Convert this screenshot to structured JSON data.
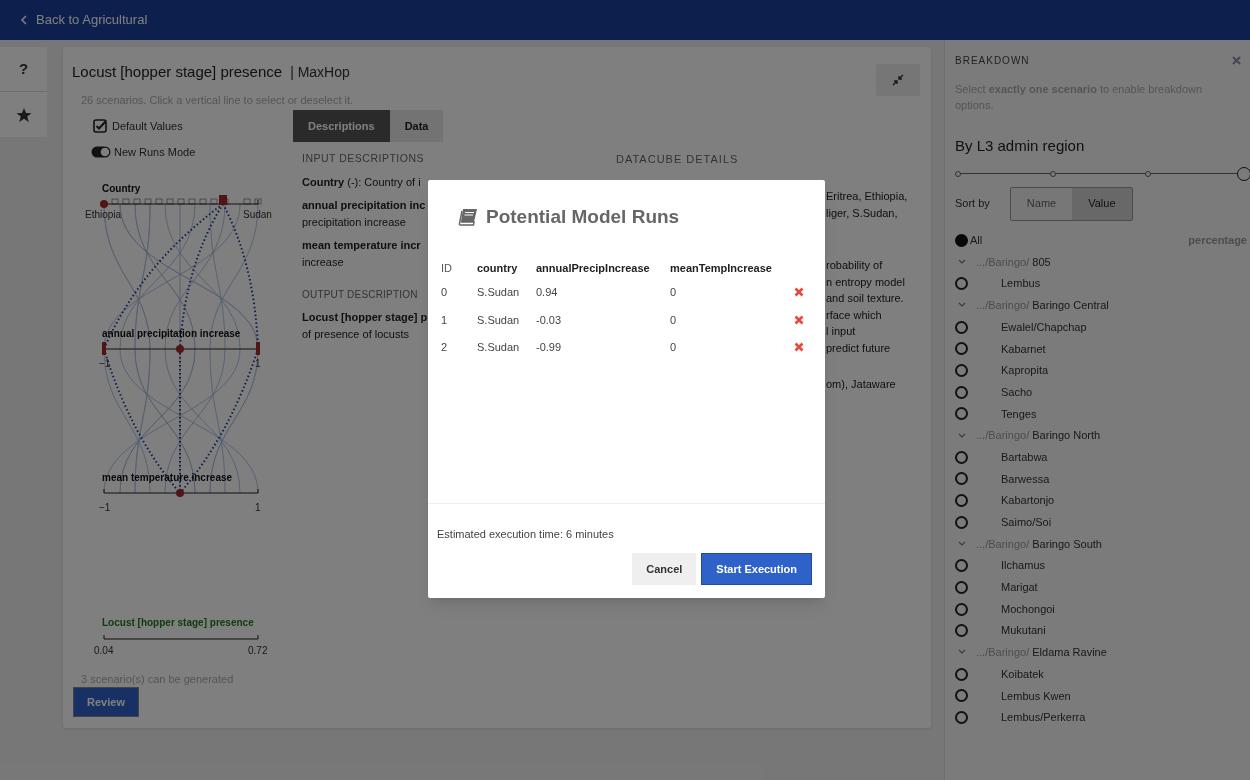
{
  "header": {
    "back_link": "Back to Agricultural"
  },
  "rail": {
    "help_button": "?"
  },
  "card": {
    "title": "Locust [hopper stage] presence",
    "model": "| MaxHop",
    "subtitle": "26 scenarios. Click a vertical line to select or deselect it.",
    "default_values": {
      "label": "Default Values",
      "checked": true
    },
    "new_runs_mode": {
      "label": "New Runs Mode",
      "on": true
    },
    "plot": {
      "axes": [
        {
          "label": "Country",
          "tick_min": "Ethiopia",
          "tick_max": "Sudan"
        },
        {
          "label": "annual precipitation increase",
          "tick_min": "−1",
          "tick_max": "1"
        },
        {
          "label": "mean temperature increase",
          "tick_min": "−1",
          "tick_max": "1"
        }
      ],
      "output_axis": {
        "label": "Locust [hopper stage] presence",
        "tick_min": "0.04",
        "tick_max": "0.72"
      }
    },
    "generated_note": "3 scenario(s) can be generated",
    "review_button": "Review"
  },
  "tabs": [
    {
      "label": "Descriptions",
      "selected": true
    },
    {
      "label": "Data",
      "selected": false
    }
  ],
  "input_descriptions": {
    "heading": "INPUT DESCRIPTIONS",
    "items": [
      [
        "**Country** (-): Country of i"
      ],
      [
        "**annual precipitation inc**",
        "precipitation increase"
      ],
      [
        "**mean temperature incr**",
        "increase"
      ]
    ]
  },
  "output_description": {
    "heading": "OUTPUT DESCRIPTION",
    "items": [
      [
        "**Locust [hopper stage] p**",
        "of presence of locusts"
      ]
    ]
  },
  "datacube_details": {
    "heading": "DATACUBE DETAILS",
    "paragraphs": [
      [
        "Eritrea, Ethiopia,",
        "liger, S.Sudan,"
      ],
      [
        "robability of",
        "n entropy model",
        "and soil texture.",
        "rface which",
        "l input",
        "predict future"
      ],
      [
        "om), Jataware"
      ]
    ]
  },
  "breakdown": {
    "heading": "BREAKDOWN",
    "hint": "Select **exactly one scenario** to enable breakdown options.",
    "level_title": "By L3 admin region",
    "levels": [
      {
        "selected": false
      },
      {
        "selected": false
      },
      {
        "selected": false
      },
      {
        "selected": true
      }
    ],
    "sort_label": "Sort by",
    "sort_options": [
      {
        "label": "Name",
        "selected": false
      },
      {
        "label": "Value",
        "selected": true
      }
    ],
    "all": {
      "label": "All",
      "selected": true
    },
    "column_label": "percentage",
    "regions": [
      {
        "prefix": ".../Baringo/",
        "name": "805",
        "expanded": true,
        "children": [
          {
            "name": "Lembus",
            "selected": false
          }
        ]
      },
      {
        "prefix": ".../Baringo/",
        "name": "Baringo Central",
        "expanded": true,
        "children": [
          {
            "name": "Ewalel/Chapchap",
            "selected": false
          },
          {
            "name": "Kabarnet",
            "selected": false
          },
          {
            "name": "Kapropita",
            "selected": false
          },
          {
            "name": "Sacho",
            "selected": false
          },
          {
            "name": "Tenges",
            "selected": false
          }
        ]
      },
      {
        "prefix": ".../Baringo/",
        "name": "Baringo North",
        "expanded": true,
        "children": [
          {
            "name": "Bartabwa",
            "selected": false
          },
          {
            "name": "Barwessa",
            "selected": false
          },
          {
            "name": "Kabartonjo",
            "selected": false
          },
          {
            "name": "Saimo/Soi",
            "selected": false
          }
        ]
      },
      {
        "prefix": ".../Baringo/",
        "name": "Baringo South",
        "expanded": true,
        "children": [
          {
            "name": "Ilchamus",
            "selected": false
          },
          {
            "name": "Marigat",
            "selected": false
          },
          {
            "name": "Mochongoi",
            "selected": false
          },
          {
            "name": "Mukutani",
            "selected": false
          }
        ]
      },
      {
        "prefix": ".../Baringo/",
        "name": "Eldama Ravine",
        "expanded": true,
        "children": [
          {
            "name": "Koibatek",
            "selected": false
          },
          {
            "name": "Lembus Kwen",
            "selected": false
          },
          {
            "name": "Lembus/Perkerra",
            "selected": false
          }
        ]
      }
    ]
  },
  "modal": {
    "title": "Potential Model Runs",
    "columns": [
      "ID",
      "country",
      "annualPrecipIncrease",
      "meanTempIncrease"
    ],
    "rows": [
      [
        "0",
        "S.Sudan",
        "0.94",
        "0"
      ],
      [
        "1",
        "S.Sudan",
        "-0.03",
        "0"
      ],
      [
        "2",
        "S.Sudan",
        "-0.99",
        "0"
      ]
    ],
    "estimate": "Estimated execution time: 6 minutes",
    "cancel_button": "Cancel",
    "start_button": "Start Execution"
  }
}
